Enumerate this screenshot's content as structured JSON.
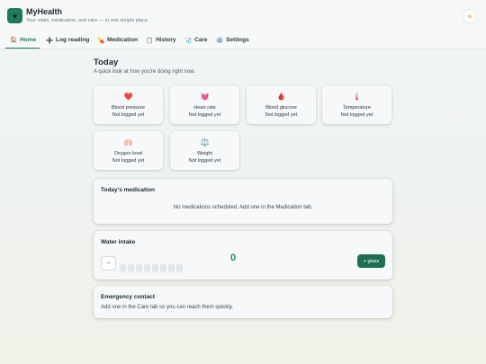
{
  "app": {
    "title": "MyHealth",
    "subtitle": "Your vitals, medication, and care — in one simple place",
    "logo_icon": "heart-icon",
    "theme_icon": "sun-icon"
  },
  "nav": {
    "tabs": [
      {
        "label": "Home",
        "icon": "🏠"
      },
      {
        "label": "Log reading",
        "icon": "➕"
      },
      {
        "label": "Medication",
        "icon": "💊"
      },
      {
        "label": "History",
        "icon": "📋"
      },
      {
        "label": "Care",
        "icon": "🩺"
      },
      {
        "label": "Settings",
        "icon": "⚙️"
      }
    ],
    "active_tab": "Home"
  },
  "today": {
    "title": "Today",
    "subtitle": "A quick look at how you're doing right now.",
    "vitals": [
      {
        "name": "Blood pressure",
        "value": "Not logged yet",
        "icon": "❤️",
        "icon_name": "heart-icon"
      },
      {
        "name": "Heart rate",
        "value": "Not logged yet",
        "icon": "💓",
        "icon_name": "beating-heart-icon"
      },
      {
        "name": "Blood glucose",
        "value": "Not logged yet",
        "icon": "🩸",
        "icon_name": "blood-drop-icon"
      },
      {
        "name": "Temperature",
        "value": "Not logged yet",
        "icon": "🌡️",
        "icon_name": "thermometer-icon"
      },
      {
        "name": "Oxygen level",
        "value": "Not logged yet",
        "icon": "🫁",
        "icon_name": "lungs-icon"
      },
      {
        "name": "Weight",
        "value": "Not logged yet",
        "icon": "⚖️",
        "icon_name": "scale-icon"
      }
    ]
  },
  "medication": {
    "title": "Today's medication",
    "empty_text": "No medications scheduled. Add one in the Medication tab."
  },
  "water": {
    "title": "Water intake",
    "minus_label": "−",
    "count": "0",
    "goal_cups": 8,
    "filled_cups": 0,
    "add_label": "+ glass"
  },
  "emergency": {
    "title": "Emergency contact",
    "text": "Add one in the Care tab so you can reach them quickly."
  },
  "colors": {
    "accent": "#1f7a5c",
    "button": "#1e6e54",
    "count": "#1f8a63"
  }
}
